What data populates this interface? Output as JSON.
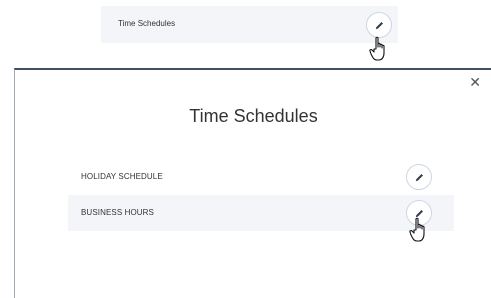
{
  "top_row": {
    "label": "Time Schedules",
    "edit_icon": "pencil-icon"
  },
  "modal": {
    "title": "Time Schedules",
    "close_icon": "close-icon",
    "items": [
      {
        "label": "HOLIDAY SCHEDULE"
      },
      {
        "label": "BUSINESS HOURS"
      }
    ]
  },
  "colors": {
    "row_bg": "#f3f5f8",
    "modal_border_top": "#3f5064",
    "pencil": "#2f3e4f",
    "button_border": "#cdd6e0"
  }
}
